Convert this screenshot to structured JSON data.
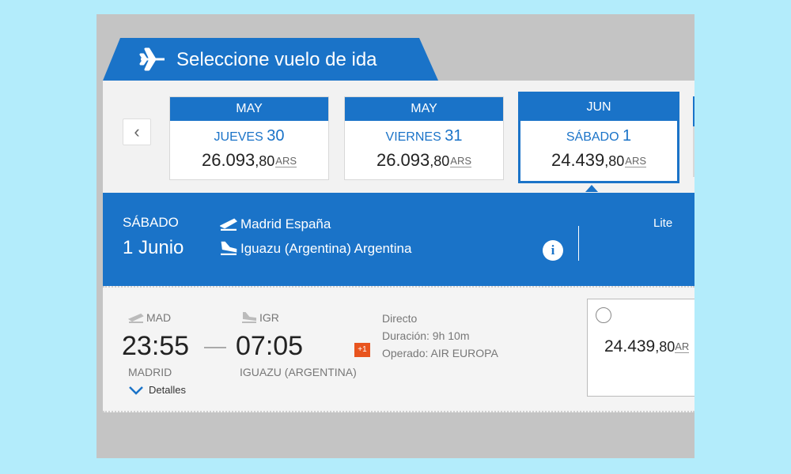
{
  "header": {
    "title": "Seleccione vuelo de ida",
    "icon": "airplane-icon",
    "color": "#1a73c8"
  },
  "date_strip": {
    "prev_icon": "chevron-left-icon",
    "dates": [
      {
        "month": "MAY",
        "weekday": "JUEVES",
        "day": "30",
        "price_int": "26.093",
        "price_dec": ",80",
        "currency": "ARS",
        "selected": false
      },
      {
        "month": "MAY",
        "weekday": "VIERNES",
        "day": "31",
        "price_int": "26.093",
        "price_dec": ",80",
        "currency": "ARS",
        "selected": false
      },
      {
        "month": "JUN",
        "weekday": "SÁBADO",
        "day": "1",
        "price_int": "24.439",
        "price_dec": ",80",
        "currency": "ARS",
        "selected": true
      }
    ]
  },
  "summary": {
    "weekday": "SÁBADO",
    "date": "1 Junio",
    "origin": "Madrid España",
    "destination": "Iguazu (Argentina) Argentina",
    "fare_class": "Lite"
  },
  "flight": {
    "origin_code": "MAD",
    "destination_code": "IGR",
    "departure_time": "23:55",
    "arrival_time": "07:05",
    "origin_city": "MADRID",
    "destination_city": "IGUAZU (ARGENTINA)",
    "day_offset": "+1",
    "stops": "Directo",
    "duration": "Duración: 9h 10m",
    "operator": "Operado: AIR EUROPA",
    "details_label": "Detalles",
    "price_int": "24.439",
    "price_dec": ",80",
    "currency": "AR"
  }
}
